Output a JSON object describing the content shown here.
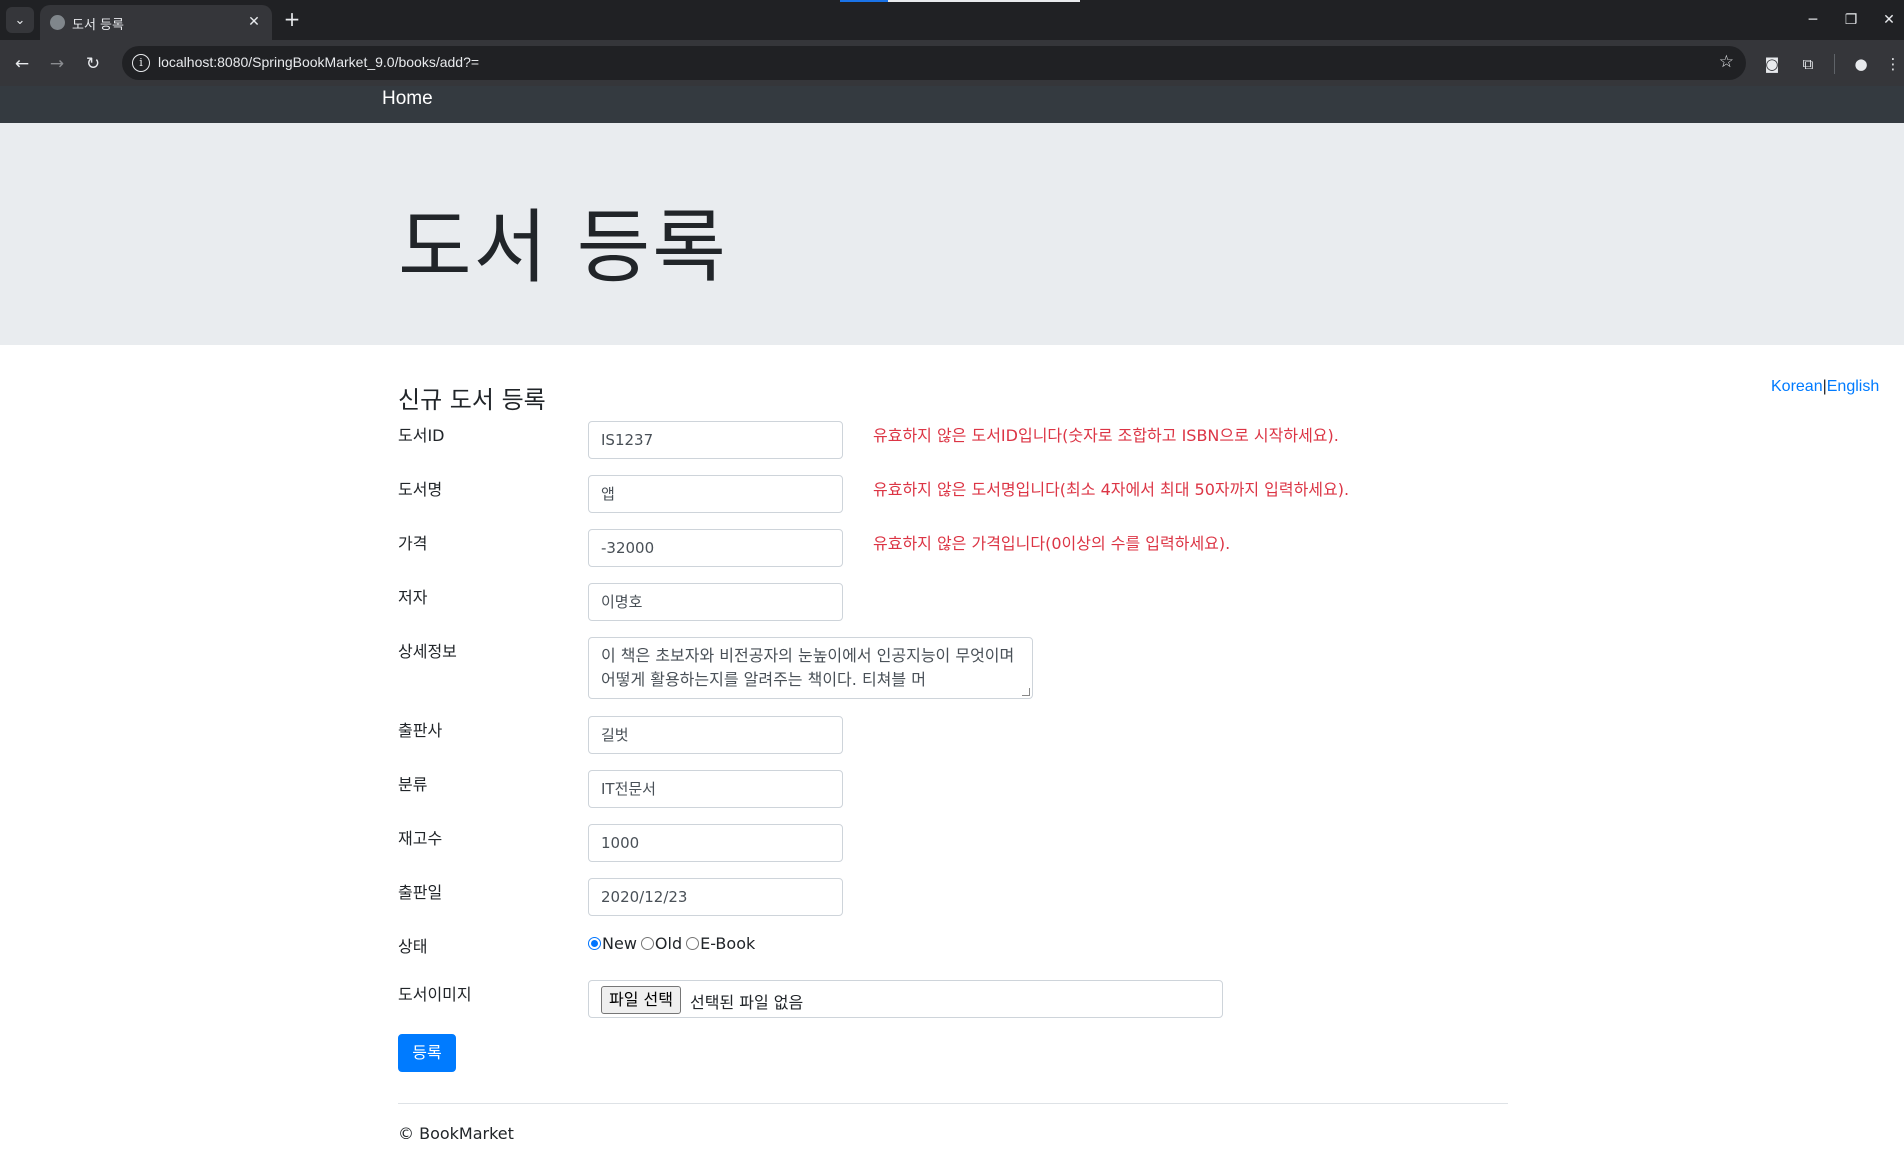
{
  "browser": {
    "tab_title": "도서 등록",
    "url": "localhost:8080/SpringBookMarket_9.0/books/add?=",
    "new_tab_symbol": "+",
    "close_symbol": "✕"
  },
  "nav": {
    "home_label": "Home"
  },
  "jumbotron": {
    "title": "도서 등록"
  },
  "lang": {
    "korean": "Korean",
    "separator": "|",
    "english": "English"
  },
  "form": {
    "title": "신규 도서 등록",
    "fields": [
      {
        "label": "도서ID",
        "value": "IS1237",
        "error": "유효하지 않은 도서ID입니다(숫자로 조합하고 ISBN으로 시작하세요)."
      },
      {
        "label": "도서명",
        "value": "앱",
        "error": "유효하지 않은 도서명입니다(최소 4자에서 최대 50자까지 입력하세요)."
      },
      {
        "label": "가격",
        "value": "-32000",
        "error": "유효하지 않은 가격입니다(0이상의 수를 입력하세요)."
      },
      {
        "label": "저자",
        "value": "이명호"
      },
      {
        "label": "상세정보",
        "value": "이 책은 초보자와 비전공자의 눈높이에서 인공지능이 무엇이며 어떻게 활용하는지를 알려주는 책이다. 티쳐블 머"
      },
      {
        "label": "출판사",
        "value": "길벗"
      },
      {
        "label": "분류",
        "value": "IT전문서"
      },
      {
        "label": "재고수",
        "value": "1000"
      },
      {
        "label": "출판일",
        "value": "2020/12/23"
      },
      {
        "label": "상태"
      },
      {
        "label": "도서이미지"
      }
    ],
    "condition_options": [
      {
        "label": "New",
        "checked": true
      },
      {
        "label": "Old",
        "checked": false
      },
      {
        "label": "E-Book",
        "checked": false
      }
    ],
    "file_button": "파일 선택",
    "file_status": "선택된 파일 없음",
    "submit_label": "등록"
  },
  "footer": {
    "text": "© BookMarket"
  },
  "colors": {
    "nav_bg": "#343a40",
    "jumbotron_bg": "#e9ecef",
    "error": "#dc3545",
    "primary": "#007bff"
  }
}
